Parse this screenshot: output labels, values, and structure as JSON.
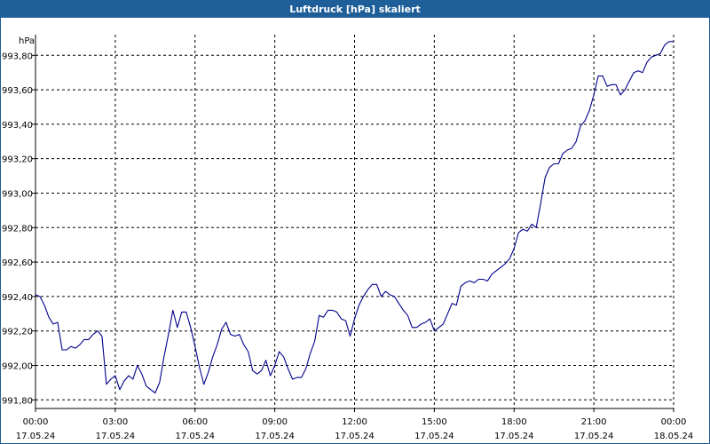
{
  "window": {
    "title": "Luftdruck [hPa] skaliert"
  },
  "colors": {
    "titlebar": "#1f5f99",
    "line": "#00008b",
    "grid": "#000000",
    "axis": "#000000"
  },
  "chart_data": {
    "type": "line",
    "title": "Luftdruck [hPa] skaliert",
    "ylabel": "hPa",
    "xlabel": "",
    "ylim": [
      991.75,
      993.92
    ],
    "xlim": [
      "2024-05-17 00:00",
      "2024-05-18 00:00"
    ],
    "grid": true,
    "y_ticks": [
      "991,80",
      "992,00",
      "992,20",
      "992,40",
      "992,60",
      "992,80",
      "993,00",
      "993,20",
      "993,40",
      "993,60",
      "993,80"
    ],
    "x_ticks": [
      {
        "time": "00:00",
        "date": "17.05.24"
      },
      {
        "time": "03:00",
        "date": "17.05.24"
      },
      {
        "time": "06:00",
        "date": "17.05.24"
      },
      {
        "time": "09:00",
        "date": "17.05.24"
      },
      {
        "time": "12:00",
        "date": "17.05.24"
      },
      {
        "time": "15:00",
        "date": "17.05.24"
      },
      {
        "time": "18:00",
        "date": "17.05.24"
      },
      {
        "time": "21:00",
        "date": "17.05.24"
      },
      {
        "time": "00:00",
        "date": "18.05.24"
      }
    ],
    "series": [
      {
        "x": [
          "00:00",
          "00:10",
          "00:20",
          "00:30",
          "00:40",
          "00:50",
          "01:00",
          "01:10",
          "01:20",
          "01:30",
          "01:40",
          "01:50",
          "02:00",
          "02:10",
          "02:20",
          "02:30",
          "02:40",
          "02:50",
          "03:00",
          "03:10",
          "03:20",
          "03:30",
          "03:40",
          "03:50",
          "04:00",
          "04:10",
          "04:20",
          "04:30",
          "04:40",
          "04:50",
          "05:00",
          "05:10",
          "05:20",
          "05:30",
          "05:40",
          "05:50",
          "06:00",
          "06:10",
          "06:20",
          "06:30",
          "06:40",
          "06:50",
          "07:00",
          "07:10",
          "07:20",
          "07:30",
          "07:40",
          "07:50",
          "08:00",
          "08:10",
          "08:20",
          "08:30",
          "08:40",
          "08:50",
          "09:00",
          "09:10",
          "09:20",
          "09:30",
          "09:40",
          "09:50",
          "10:00",
          "10:10",
          "10:20",
          "10:30",
          "10:40",
          "10:50",
          "11:00",
          "11:10",
          "11:20",
          "11:30",
          "11:40",
          "11:50",
          "12:00",
          "12:10",
          "12:20",
          "12:30",
          "12:40",
          "12:50",
          "13:00",
          "13:10",
          "13:20",
          "13:30",
          "13:40",
          "13:50",
          "14:00",
          "14:10",
          "14:20",
          "14:30",
          "14:40",
          "14:50",
          "15:00",
          "15:10",
          "15:20",
          "15:30",
          "15:40",
          "15:50",
          "16:00",
          "16:10",
          "16:20",
          "16:30",
          "16:40",
          "16:50",
          "17:00",
          "17:10",
          "17:20",
          "17:30",
          "17:40",
          "17:50",
          "18:00",
          "18:10",
          "18:20",
          "18:30",
          "18:40",
          "18:50",
          "19:00",
          "19:10",
          "19:20",
          "19:30",
          "19:40",
          "19:50",
          "20:00",
          "20:10",
          "20:20",
          "20:30",
          "20:40",
          "20:50",
          "21:00",
          "21:10",
          "21:20",
          "21:30",
          "21:40",
          "21:50",
          "22:00",
          "22:10",
          "22:20",
          "22:30",
          "22:40",
          "22:50",
          "23:00",
          "23:10",
          "23:20",
          "23:30",
          "23:40",
          "23:50",
          "24:00"
        ],
        "values": [
          992.41,
          992.4,
          992.35,
          992.28,
          992.24,
          992.25,
          992.09,
          992.09,
          992.11,
          992.1,
          992.12,
          992.15,
          992.15,
          992.18,
          992.2,
          992.17,
          991.89,
          991.92,
          991.94,
          991.86,
          991.91,
          991.94,
          991.92,
          992.0,
          991.95,
          991.88,
          991.86,
          991.84,
          991.9,
          992.05,
          992.18,
          992.32,
          992.22,
          992.31,
          992.31,
          992.22,
          992.11,
          991.99,
          991.89,
          991.96,
          992.05,
          992.12,
          992.21,
          992.25,
          992.18,
          992.17,
          992.18,
          992.12,
          992.08,
          991.97,
          991.95,
          991.97,
          992.03,
          991.94,
          992.0,
          992.08,
          992.05,
          991.98,
          991.92,
          991.93,
          991.93,
          991.98,
          992.07,
          992.14,
          992.29,
          992.28,
          992.32,
          992.32,
          992.31,
          992.27,
          992.26,
          992.17,
          992.27,
          992.35,
          992.4,
          992.44,
          992.47,
          992.47,
          992.4,
          992.43,
          992.41,
          992.4,
          992.36,
          992.32,
          992.29,
          992.22,
          992.22,
          992.24,
          992.25,
          992.27,
          992.2,
          992.22,
          992.24,
          992.3,
          992.36,
          992.35,
          992.46,
          992.48,
          992.49,
          992.48,
          992.5,
          992.5,
          992.49,
          992.53,
          992.55,
          992.57,
          992.59,
          992.62,
          992.68,
          992.77,
          992.79,
          992.78,
          992.82,
          992.8,
          992.94,
          993.09,
          993.15,
          993.17,
          993.17,
          993.23,
          993.25,
          993.26,
          993.3,
          993.39,
          993.42,
          993.48,
          993.57,
          993.68,
          993.68,
          993.62,
          993.63,
          993.63,
          993.57,
          993.6,
          993.65,
          993.7,
          993.71,
          993.7,
          993.76,
          993.79,
          993.8,
          993.81,
          993.86,
          993.88,
          993.88
        ]
      }
    ]
  }
}
